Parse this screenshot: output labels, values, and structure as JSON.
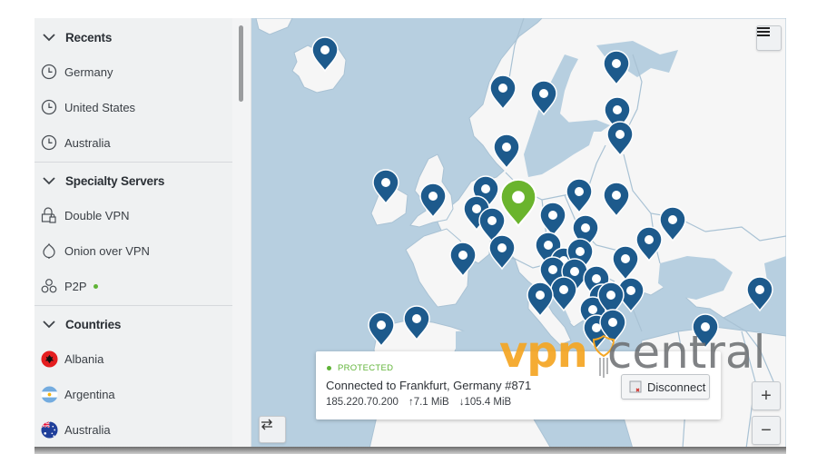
{
  "sidebar": {
    "sections": [
      {
        "title": "Recents",
        "items": [
          {
            "label": "Germany",
            "icon": "clock-icon"
          },
          {
            "label": "United States",
            "icon": "clock-icon"
          },
          {
            "label": "Australia",
            "icon": "clock-icon"
          }
        ]
      },
      {
        "title": "Specialty Servers",
        "items": [
          {
            "label": "Double VPN",
            "icon": "double-lock-icon"
          },
          {
            "label": "Onion over VPN",
            "icon": "onion-icon"
          },
          {
            "label": "P2P",
            "icon": "p2p-icon",
            "status_dot": true
          }
        ]
      },
      {
        "title": "Countries",
        "items": [
          {
            "label": "Albania",
            "icon": "albania-flag-icon"
          },
          {
            "label": "Argentina",
            "icon": "argentina-flag-icon"
          },
          {
            "label": "Australia",
            "icon": "australia-flag-icon"
          }
        ]
      }
    ]
  },
  "map": {
    "active_location": "Frankfurt, Germany",
    "menu_icon": "hamburger-menu-icon",
    "zoom_in_label": "+",
    "zoom_out_label": "−",
    "swap_icon": "swap-arrows-icon"
  },
  "status": {
    "state": "PROTECTED",
    "connection": "Connected to Frankfurt, Germany #871",
    "ip": "185.220.70.200",
    "upload": "↑7.1 MiB",
    "download": "↓105.4 MiB",
    "disconnect_label": "Disconnect"
  },
  "watermark": {
    "part1": "vpn",
    "part2": "central"
  },
  "colors": {
    "accent_green": "#6ab42d",
    "pin_blue": "#1d5a8c",
    "water": "#b7cfe0",
    "land": "#f6f6f6",
    "watermark_orange": "#f5a623"
  }
}
